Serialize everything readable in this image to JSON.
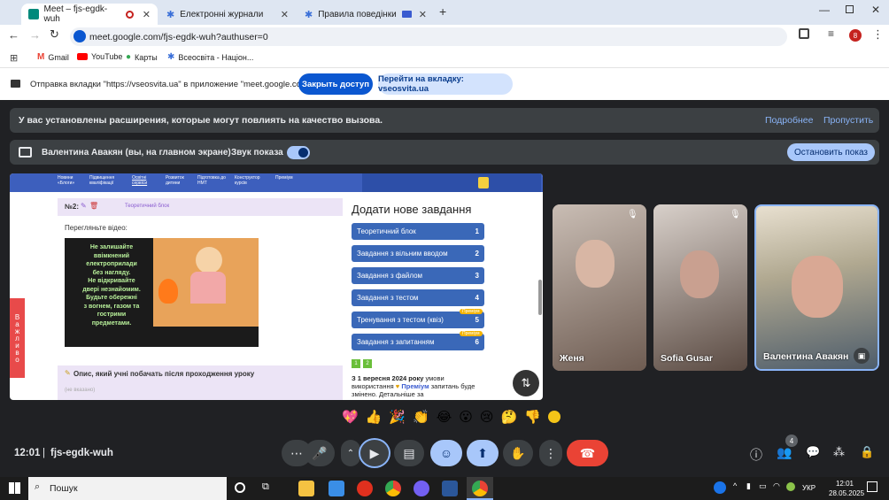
{
  "browser": {
    "tabs": [
      {
        "label": "Meet – fjs-egdk-wuh",
        "active": true
      },
      {
        "label": "Електронні журнали",
        "active": false
      },
      {
        "label": "Правила поведінки під ча",
        "active": false
      }
    ],
    "url": "meet.google.com/fjs-egdk-wuh?authuser=0",
    "profile_initial": "8",
    "bookmarks": [
      "Gmail",
      "YouTube",
      "Карты",
      "Всеосвіта - Націон..."
    ]
  },
  "share_notice": {
    "text": "Отправка вкладки \"https://vseosvita.ua\" в приложение \"meet.google.com\"...",
    "stop_label": "Закрыть доступ",
    "goto_label": "Перейти на вкладку: vseosvita.ua"
  },
  "extension_bar": {
    "text": "У вас установлены расширения, которые могут повлиять на качество вызова.",
    "details_label": "Подробнее",
    "skip_label": "Пропустить"
  },
  "presenting_bar": {
    "presenter": "Валентина Авакян (вы, на главном экране)",
    "sound_label": "Звук показа",
    "stop_label": "Остановить показ"
  },
  "shared_page": {
    "nav": [
      "Новини «Блоги»",
      "Підвищення кваліфікації",
      "Освітні сервіси",
      "Розвиток дитини",
      "Підготовка до НМТ",
      "Конструктор курсів",
      "Преміум"
    ],
    "task_number": "№2:",
    "task_tag": "Теоретичний блок",
    "watch_label": "Перегляньте відео:",
    "video_lines": [
      "Не залишайте",
      "ввімкнений",
      "електроприлади",
      "без нагляду.",
      "Не відкривайте",
      "двері незнайомим.",
      "Будьте обережні",
      "з вогнем, газом та",
      "гострими",
      "предметами."
    ],
    "side_tab": "Важливо",
    "opis_label": "Опис, який учні побачать після проходження уроку",
    "opis_placeholder": "(не вказано)",
    "add_title": "Додати нове завдання",
    "add_items": [
      {
        "label": "Теоретичний блок",
        "count": "1",
        "badge": ""
      },
      {
        "label": "Завдання з вільним вводом",
        "count": "2",
        "badge": ""
      },
      {
        "label": "Завдання з файлом",
        "count": "3",
        "badge": ""
      },
      {
        "label": "Завдання з тестом",
        "count": "4",
        "badge": ""
      },
      {
        "label": "Тренування з тестом (квіз)",
        "count": "5",
        "badge": "Преміум"
      },
      {
        "label": "Завдання з запитанням",
        "count": "6",
        "badge": "Преміум"
      }
    ],
    "pages": [
      "1",
      "2"
    ],
    "notice_bold": "З 1 вересня 2024 року",
    "notice_rest": " умови використання",
    "notice_premium": "Преміум",
    "notice_tail": " запитань буде змінено. Детальніше за"
  },
  "participants": [
    {
      "name": "Женя",
      "muted": true
    },
    {
      "name": "Sofia Gusar",
      "muted": true
    },
    {
      "name": "Валентина Авакян",
      "muted": false
    }
  ],
  "reactions": [
    "💖",
    "👍",
    "🎉",
    "👏",
    "😂",
    "😮",
    "😢",
    "🤔",
    "👎"
  ],
  "footer": {
    "time": "12:01",
    "meeting_code": "fjs-egdk-wuh",
    "people_count": "4"
  },
  "taskbar": {
    "search_label": "Пошук",
    "lang": "УКР",
    "time": "12:01",
    "date": "28.05.2025"
  },
  "colors": {
    "accent": "#0b57d0",
    "meet_bg": "#202124",
    "end_call": "#ea4335",
    "active_ctrl": "#a8c7fa"
  }
}
